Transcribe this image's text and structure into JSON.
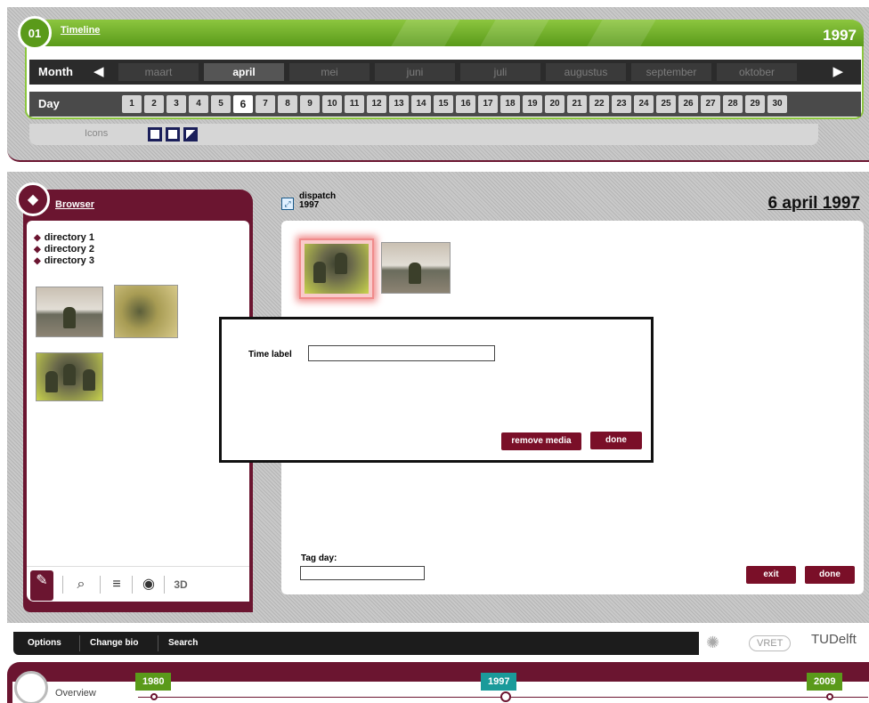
{
  "timeline": {
    "title": "Timeline",
    "logo_text": "01",
    "year": "1997",
    "month_label": "Month",
    "months": [
      "maart",
      "april",
      "mei",
      "juni",
      "juli",
      "augustus",
      "september",
      "oktober"
    ],
    "active_month": "april",
    "day_label": "Day",
    "days": [
      "1",
      "2",
      "3",
      "4",
      "5",
      "6",
      "7",
      "8",
      "9",
      "10",
      "11",
      "12",
      "13",
      "14",
      "15",
      "16",
      "17",
      "18",
      "19",
      "20",
      "21",
      "22",
      "23",
      "24",
      "25",
      "26",
      "27",
      "28",
      "29",
      "30"
    ],
    "active_day": "6",
    "icons_label": "Icons"
  },
  "browser": {
    "title": "Browser",
    "directories": [
      "directory 1",
      "directory 2",
      "directory 3"
    ],
    "tab_3d_label": "3D"
  },
  "editor": {
    "item_title_line1": "dispatch",
    "item_title_line2": "1997",
    "date_title": "6 april 1997",
    "tag_day_label": "Tag day:",
    "exit_label": "exit",
    "done_label": "done"
  },
  "modal": {
    "time_label": "Time label",
    "remove_media_label": "remove media",
    "done_label": "done"
  },
  "menu": {
    "items": [
      "Options",
      "Change bio",
      "Search"
    ],
    "tudelft_logo": "TUDelft"
  },
  "overview": {
    "label": "Overview",
    "year_start": "1980",
    "year_current": "1997",
    "year_end": "2009"
  }
}
